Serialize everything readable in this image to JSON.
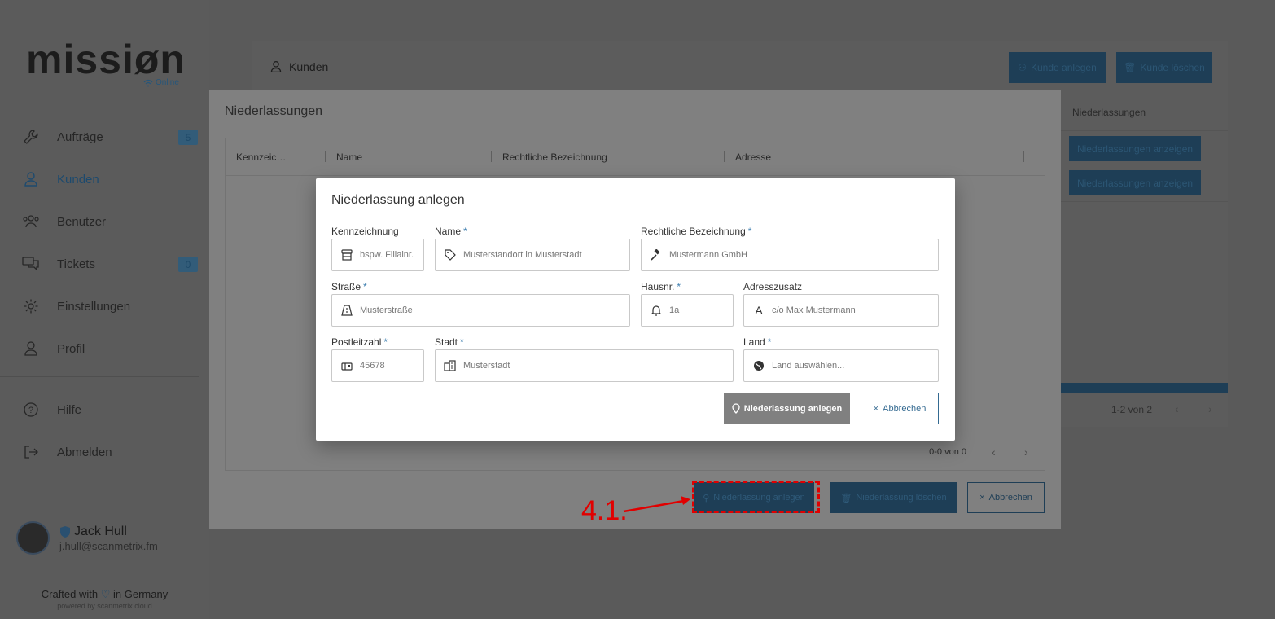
{
  "app": {
    "logo_text": "missiøn",
    "status": "Online"
  },
  "sidebar": {
    "items": [
      {
        "label": "Aufträge",
        "badge": "5",
        "icon": "wrench-icon"
      },
      {
        "label": "Kunden",
        "icon": "user-icon"
      },
      {
        "label": "Benutzer",
        "icon": "users-icon"
      },
      {
        "label": "Tickets",
        "badge": "0",
        "icon": "chat-icon"
      },
      {
        "label": "Einstellungen",
        "icon": "gear-icon"
      },
      {
        "label": "Profil",
        "icon": "person-icon"
      },
      {
        "label": "Hilfe",
        "icon": "help-icon"
      },
      {
        "label": "Abmelden",
        "icon": "logout-icon"
      }
    ],
    "user": {
      "name": "Jack Hull",
      "email": "j.hull@scanmetrix.fm"
    },
    "footer": {
      "line1_pre": "Crafted with",
      "line1_post": "in Germany",
      "line2": "powered by scanmetrix cloud"
    }
  },
  "background": {
    "title": "Kunden",
    "create_button": "Kunde anlegen",
    "delete_button": "Kunde löschen",
    "column_header": "Niederlassungen",
    "show_buttons": [
      "Niederlassungen anzeigen",
      "Niederlassungen anzeigen"
    ],
    "pagination": "1-2 von 2"
  },
  "branches_modal": {
    "title": "Niederlassungen",
    "columns": [
      "Kennzeic…",
      "Name",
      "Rechtliche Bezeichnung",
      "Adresse"
    ],
    "pagination": "0-0 von 0",
    "create_button": "Niederlassung anlegen",
    "delete_button": "Niederlassung löschen",
    "cancel_button": "Abbrechen",
    "annotation": "4.1."
  },
  "create_dialog": {
    "title": "Niederlassung anlegen",
    "fields": {
      "kennzeichnung": {
        "label": "Kennzeichnung",
        "placeholder": "bspw. Filialnr."
      },
      "name": {
        "label": "Name",
        "placeholder": "Musterstandort in Musterstadt"
      },
      "rechtliche": {
        "label": "Rechtliche Bezeichnung",
        "placeholder": "Mustermann GmbH"
      },
      "strasse": {
        "label": "Straße",
        "placeholder": "Musterstraße"
      },
      "hausnr": {
        "label": "Hausnr.",
        "placeholder": "1a"
      },
      "adresszusatz": {
        "label": "Adresszusatz",
        "placeholder": "c/o Max Mustermann"
      },
      "plz": {
        "label": "Postleitzahl",
        "placeholder": "45678"
      },
      "stadt": {
        "label": "Stadt",
        "placeholder": "Musterstadt"
      },
      "land": {
        "label": "Land",
        "placeholder": "Land auswählen..."
      }
    },
    "required_marker": "*",
    "save_button": "Niederlassung anlegen",
    "cancel_button": "Abbrechen"
  }
}
